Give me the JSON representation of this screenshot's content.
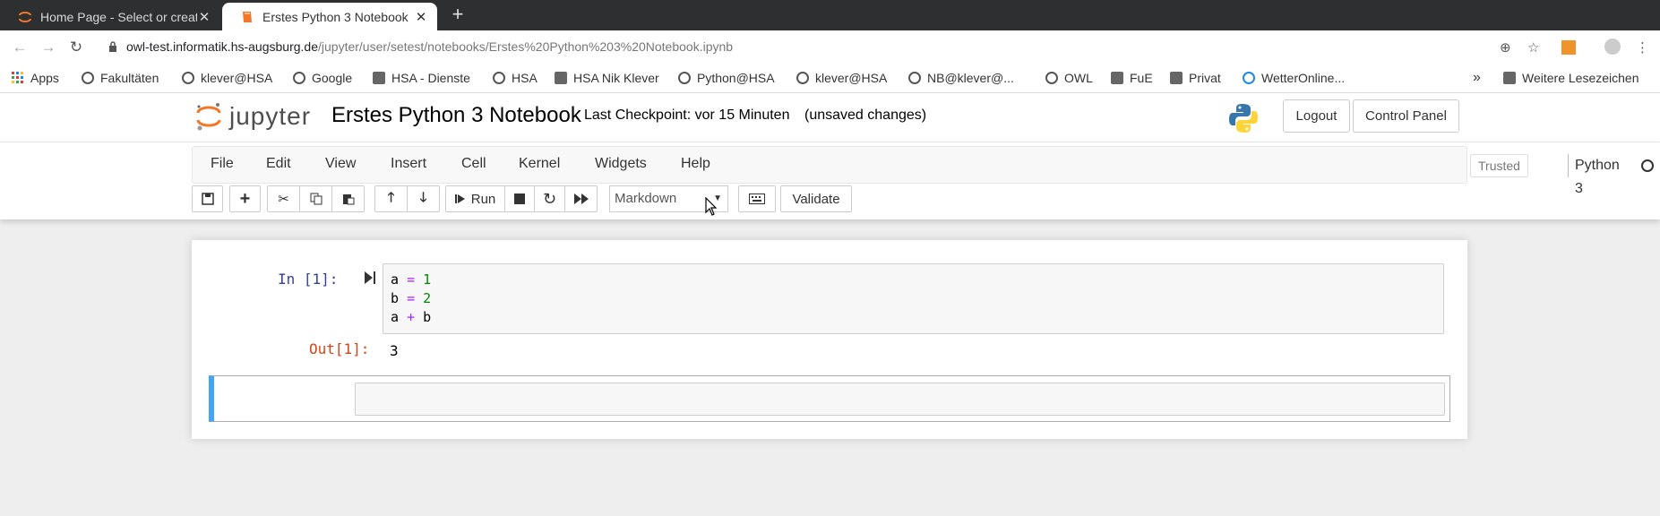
{
  "browser": {
    "tabs": [
      {
        "title": "Home Page - Select or create a notebook",
        "active": false
      },
      {
        "title": "Erstes Python 3 Notebook",
        "active": true
      }
    ],
    "new_tab_label": "+",
    "url_host": "owl-test.informatik.hs-augsburg.de",
    "url_path": "/jupyter/user/setest/notebooks/Erstes%20Python%203%20Notebook.ipynb",
    "bookmarks": [
      {
        "label": "Apps",
        "icon": "apps-grid-icon"
      },
      {
        "label": "Fakultäten",
        "icon": "globe-icon"
      },
      {
        "label": "klever@HSA",
        "icon": "globe-icon"
      },
      {
        "label": "Google",
        "icon": "globe-icon"
      },
      {
        "label": "HSA - Dienste",
        "icon": "folder-icon"
      },
      {
        "label": "HSA",
        "icon": "globe-icon"
      },
      {
        "label": "HSA Nik Klever",
        "icon": "folder-icon"
      },
      {
        "label": "Python@HSA",
        "icon": "globe-icon"
      },
      {
        "label": "klever@HSA",
        "icon": "globe-icon"
      },
      {
        "label": "NB@klever@...",
        "icon": "globe-icon"
      },
      {
        "label": "OWL",
        "icon": "globe-icon"
      },
      {
        "label": "FuE",
        "icon": "folder-icon"
      },
      {
        "label": "Privat",
        "icon": "folder-icon"
      },
      {
        "label": "WetterOnline...",
        "icon": "weather-icon"
      }
    ],
    "bookmarks_overflow": "»",
    "other_bookmarks": "Weitere Lesezeichen"
  },
  "jupyter": {
    "logo_text": "jupyter",
    "notebook_name": "Erstes Python 3 Notebook",
    "checkpoint": "Last Checkpoint: vor 15 Minuten",
    "unsaved": "(unsaved changes)",
    "logout_label": "Logout",
    "control_panel_label": "Control Panel",
    "menu": [
      "File",
      "Edit",
      "View",
      "Insert",
      "Cell",
      "Kernel",
      "Widgets",
      "Help"
    ],
    "trusted_label": "Trusted",
    "kernel_name": "Python 3",
    "run_label": "Run",
    "cell_type": "Markdown",
    "validate_label": "Validate"
  },
  "cells": {
    "in_prompt": "In [1]:",
    "out_prompt": "Out[1]:",
    "code_lines": [
      {
        "var": "a ",
        "op": "=",
        "rest": " 1"
      },
      {
        "var": "b ",
        "op": "=",
        "rest": " 2"
      },
      {
        "var": "a ",
        "op": "+",
        "rest": " b"
      }
    ],
    "output_value": "3"
  },
  "colors": {
    "selected_cell_border": "#42a5f5",
    "in_prompt": "#303f9f",
    "out_prompt": "#d84315",
    "operator": "#aa22ff",
    "number": "#008800"
  }
}
